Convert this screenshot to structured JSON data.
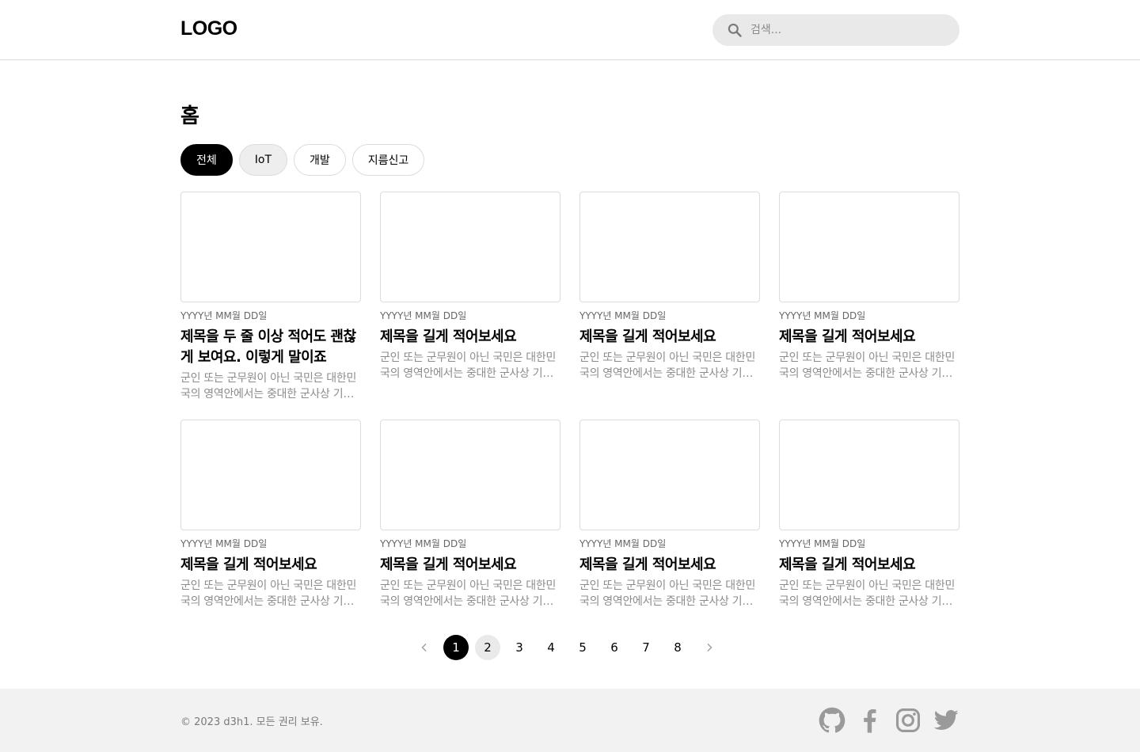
{
  "header": {
    "logo": "LOGO",
    "search_placeholder": "검색...",
    "search_icon": "search-icon"
  },
  "main": {
    "page_title": "홈",
    "tabs": [
      {
        "label": "전체",
        "state": "active"
      },
      {
        "label": "IoT",
        "state": "hover"
      },
      {
        "label": "개발",
        "state": "default"
      },
      {
        "label": "지름신고",
        "state": "default"
      }
    ],
    "posts": [
      {
        "date": "YYYY년 MM월 DD일",
        "title": "제목을 두 줄 이상 적어도 괜찮게 보여요. 이렇게 말이죠",
        "excerpt": "군인 또는 군무원이 아닌 국민은 대한민국의 영역안에서는 중대한 군사상 기밀·초병·초소·유독음식물공급·포로·군용물에 관한 죄"
      },
      {
        "date": "YYYY년 MM월 DD일",
        "title": "제목을 길게 적어보세요",
        "excerpt": "군인 또는 군무원이 아닌 국민은 대한민국의 영역안에서는 중대한 군사상 기밀·초병·초소·유독음식물공급·포로·군용물에 관한 죄"
      },
      {
        "date": "YYYY년 MM월 DD일",
        "title": "제목을 길게 적어보세요",
        "excerpt": "군인 또는 군무원이 아닌 국민은 대한민국의 영역안에서는 중대한 군사상 기밀·초병·초소·유독음식물공급·포로·군용물에 관한 죄"
      },
      {
        "date": "YYYY년 MM월 DD일",
        "title": "제목을 길게 적어보세요",
        "excerpt": "군인 또는 군무원이 아닌 국민은 대한민국의 영역안에서는 중대한 군사상 기밀·초병·초소·유독음식물공급·포로·군용물에 관한 죄"
      },
      {
        "date": "YYYY년 MM월 DD일",
        "title": "제목을 길게 적어보세요",
        "excerpt": "군인 또는 군무원이 아닌 국민은 대한민국의 영역안에서는 중대한 군사상 기밀·초병·초소·유독음식물공급·포로·군용물에 관한 죄"
      },
      {
        "date": "YYYY년 MM월 DD일",
        "title": "제목을 길게 적어보세요",
        "excerpt": "군인 또는 군무원이 아닌 국민은 대한민국의 영역안에서는 중대한 군사상 기밀·초병·초소·유독음식물공급·포로·군용물에 관한 죄"
      },
      {
        "date": "YYYY년 MM월 DD일",
        "title": "제목을 길게 적어보세요",
        "excerpt": "군인 또는 군무원이 아닌 국민은 대한민국의 영역안에서는 중대한 군사상 기밀·초병·초소·유독음식물공급·포로·군용물에 관한 죄"
      },
      {
        "date": "YYYY년 MM월 DD일",
        "title": "제목을 길게 적어보세요",
        "excerpt": "군인 또는 군무원이 아닌 국민은 대한민국의 영역안에서는 중대한 군사상 기밀·초병·초소·유독음식물공급·포로·군용물에 관한 죄"
      }
    ],
    "pagination": {
      "prev_icon": "chevron-left-icon",
      "next_icon": "chevron-right-icon",
      "pages": [
        "1",
        "2",
        "3",
        "4",
        "5",
        "6",
        "7",
        "8"
      ],
      "current": "1",
      "hover": "2"
    }
  },
  "footer": {
    "copyright": "© 2023 d3h1. 모든 권리 보유.",
    "socials": [
      "github-icon",
      "facebook-icon",
      "instagram-icon",
      "twitter-icon"
    ],
    "icon_color": "#9a9a9a"
  },
  "colors": {
    "accent": "#000000",
    "border": "#dcdcdc",
    "search_bg": "#e9e9e9",
    "footer_bg": "#f2f2f2",
    "muted_text": "#8c8c8c"
  }
}
